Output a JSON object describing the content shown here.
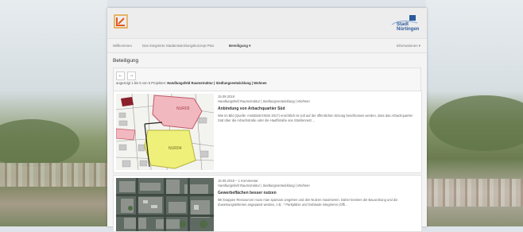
{
  "nav": {
    "items": [
      {
        "label": "Willkommen"
      },
      {
        "label": "Das integrierte Stadtentwicklungskonzept Plus"
      },
      {
        "label": "Beteiligung ▾"
      }
    ],
    "right_label": "Informationen ▾"
  },
  "logo": {
    "right_text": "Stadt Nürtingen"
  },
  "page": {
    "title": "Beteiligung",
    "prev_icon": "←",
    "next_icon": "→",
    "results_prefix": "angezeigt 1 bis 5 von 6 Projekten:",
    "results_filter": "Handlungsfeld Raumstruktur | Siedlungsentwicklung | Wohnen"
  },
  "articles": [
    {
      "date": "15.09.2018",
      "category": "Handlungsfeld Raumstruktur | Siedlungsentwicklung | Wohnen",
      "title": "Anbindung von Arbachquartier Süd",
      "excerpt": "Wie im Bild (Quelle: Amtsblatt KW34 2017) ersichtlich ist soll auf der öffentlichen Sitzung beschlossen werden, dass das Arbachquartier Süd über die Arbachstraße oder die Hauffstraße ans Straßennetz…",
      "map_labels": [
        "NUR03",
        "NUR04"
      ]
    },
    {
      "date": "15.09.2018 – 1 Kommentar",
      "category": "Handlungsfeld Raumstruktur | Siedlungsentwicklung | Wohnen",
      "title": "Gewerbeflächen besser nutzen",
      "excerpt": "Mit knappen Ressourcen muss man sparsam umgehen und den Nutzen maximieren. Daher könnten die Bauordnung und die Zuweisungskriterien angepasst werden, z.B.: * Parkplätze und Gebäude integrieren (Offi…"
    }
  ]
}
